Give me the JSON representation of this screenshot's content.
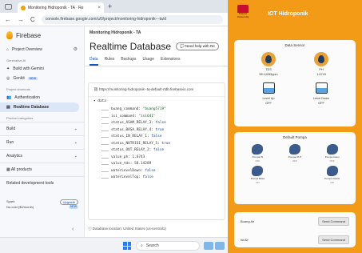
{
  "browser": {
    "tab_title": "Monitoring Hidroponik - TA · Re",
    "tab_close": "×",
    "new_tab": "+",
    "back": "←",
    "forward": "→",
    "reload": "C",
    "url": "console.firebase.google.com/u/0/project/monitoring-hidroponik---ta/d"
  },
  "sidebar": {
    "brand": "Firebase",
    "project_overview": "Project Overview",
    "caption_generative": "Generative AI",
    "build_with_gemini": "Build with Gemini",
    "genkit": "Genkit",
    "genkit_badge": "NEW",
    "caption_shortcuts": "Project shortcuts",
    "authentication": "Authentication",
    "realtime_database": "Realtime Database",
    "caption_categories": "Product categories",
    "groups": [
      "Build",
      "Run",
      "Analytics"
    ],
    "all_products": "All products",
    "related_tools": "Related development tools",
    "plan_name": "Spark",
    "plan_sub": "No-cost ($0/month)",
    "upgrade": "Upgrade",
    "upgrade_badge": "NEW",
    "collapse": "‹"
  },
  "main": {
    "breadcrumb": "Monitoring Hidroponik - TA",
    "title": "Realtime Database",
    "help_button": "Need help with Re",
    "tabs": [
      "Data",
      "Rules",
      "Backups",
      "Usage",
      "Extensions"
    ],
    "db_url": "https://monitoring-hidroponik--ta-default-rtdb.firebaseio.com",
    "root": "data",
    "nodes": [
      {
        "key": "buang_command:",
        "value": "\"buang5719\"",
        "kind": "str"
      },
      {
        "key": "isi_command:",
        "value": "\"isi641\"",
        "kind": "str"
      },
      {
        "key": "status_ASAM_RELAY_3:",
        "value": "false",
        "kind": "bool"
      },
      {
        "key": "status_BASA_RELAY_4:",
        "value": "true",
        "kind": "bool"
      },
      {
        "key": "status_IN_RELAY_1:",
        "value": "false",
        "kind": "bool"
      },
      {
        "key": "status_NUTRISI_RELAY_5:",
        "value": "true",
        "kind": "bool"
      },
      {
        "key": "status_OUT_RELAY_2:",
        "value": "false",
        "kind": "bool"
      },
      {
        "key": "value_ph:",
        "value": "1.6743",
        "kind": "num"
      },
      {
        "key": "value_tds:",
        "value": "58.14289",
        "kind": "num"
      },
      {
        "key": "waterLevelDown:",
        "value": "false",
        "kind": "bool"
      },
      {
        "key": "waterLevelTop:",
        "value": "false",
        "kind": "bool"
      }
    ],
    "location": "Database location: United States (us-central1)"
  },
  "app": {
    "logo_text": "Telkom University",
    "title": "IOT Hidroponik",
    "sensor_card_title": "Data Sensor",
    "sensors": [
      {
        "label": "TDS",
        "value": "58.14289ppm",
        "icon": "water-drop-icon"
      },
      {
        "label": "PH",
        "value": "1.6743",
        "icon": "water-drop-icon"
      },
      {
        "label": "Level Up",
        "value": "OFF",
        "icon": "water-tank-icon"
      },
      {
        "label": "Level Down",
        "value": "OFF",
        "icon": "water-tank-icon"
      }
    ],
    "pump_card_title": "Default Pompa",
    "pumps": [
      {
        "label": "Pompa IN",
        "value": "OFF"
      },
      {
        "label": "Pompa OUT",
        "value": "OFF"
      },
      {
        "label": "Pompa Asam",
        "value": "OFF"
      },
      {
        "label": "Pompa Basa",
        "value": "ON"
      },
      {
        "label": "",
        "value": ""
      },
      {
        "label": "Pompa Nutrisi",
        "value": "ON"
      }
    ],
    "commands": [
      {
        "label": "Buang Air",
        "button": "Send Command"
      },
      {
        "label": "Isi Air",
        "button": "Send Command"
      }
    ]
  },
  "taskbar": {
    "search": "Search"
  }
}
